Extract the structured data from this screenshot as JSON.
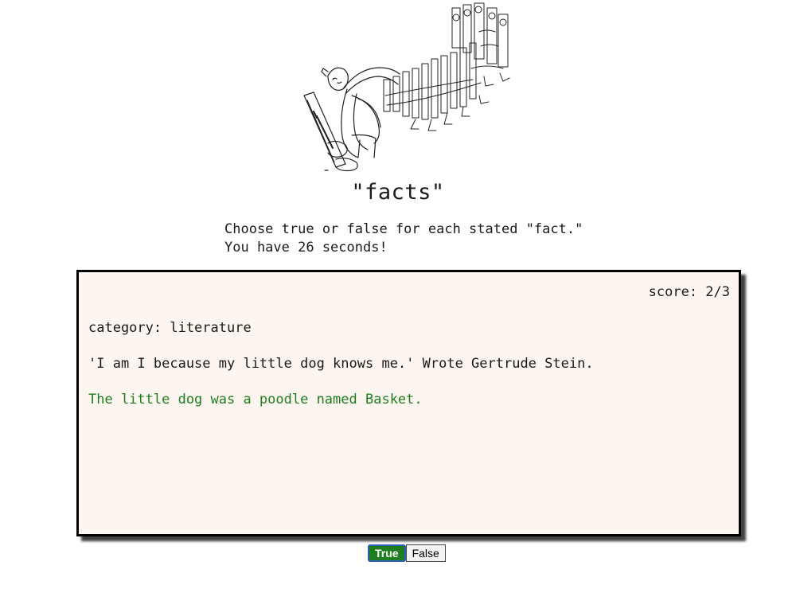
{
  "header": {
    "title": "\"facts\""
  },
  "instructions": {
    "line1": "Choose true or false for each stated \"fact.\"",
    "line2": "You have 26 seconds!"
  },
  "card": {
    "score": "score: 2/3",
    "category": "category: literature",
    "statement": "'I am I because my little dog knows me.' Wrote Gertrude Stein.",
    "fact": "The little dog was a poodle named Basket."
  },
  "buttons": {
    "true_label": "True",
    "false_label": "False"
  },
  "colors": {
    "card_background": "#fdf6f0",
    "fact_text": "#1e7d1e",
    "true_button": "#1e7d1e",
    "true_button_border": "#2b5fb8"
  },
  "illustration": {
    "icon": "pianist-illustration"
  }
}
